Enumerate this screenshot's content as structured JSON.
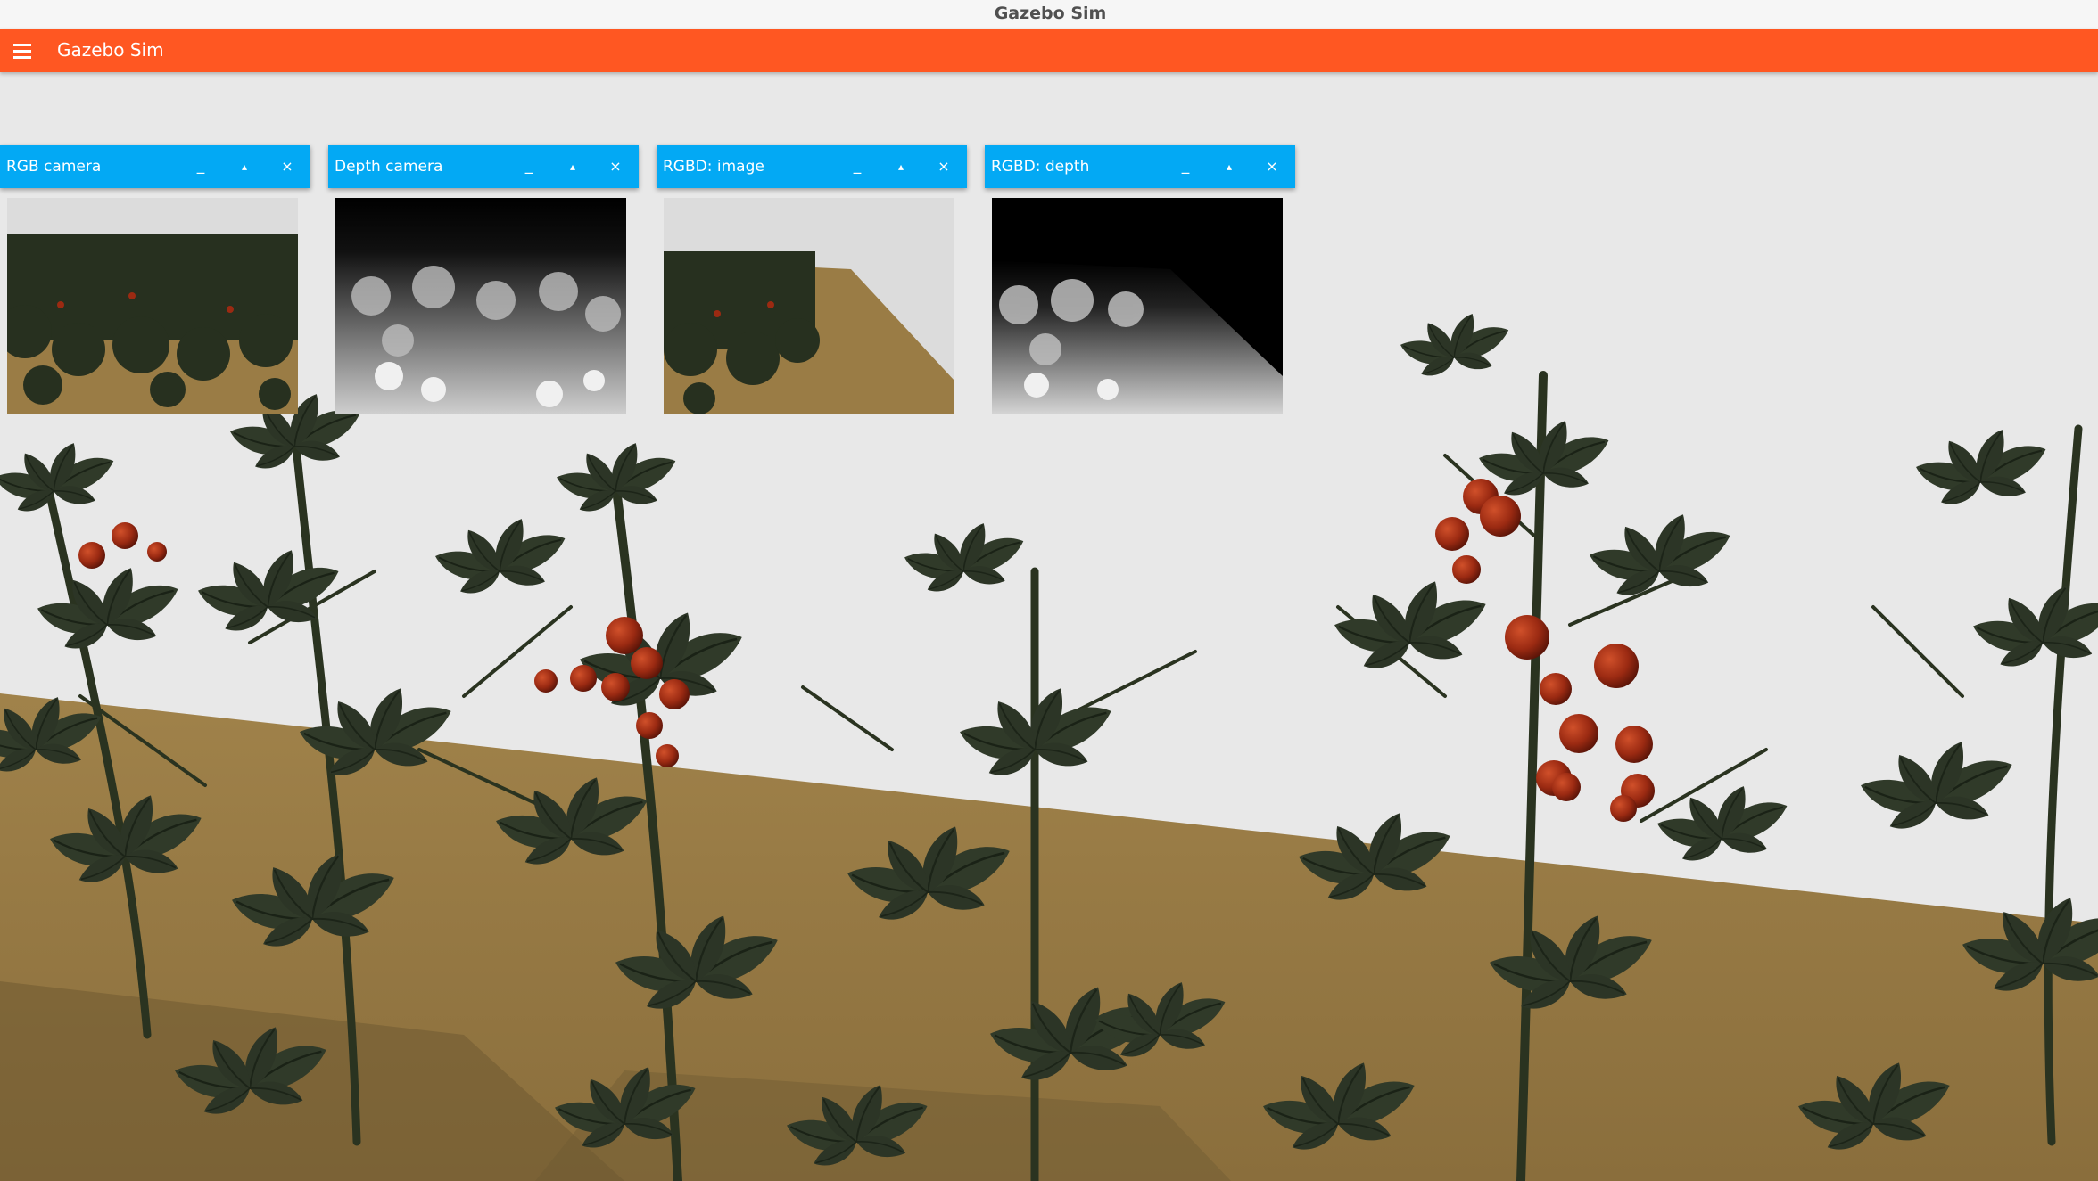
{
  "window": {
    "title": "Gazebo Sim"
  },
  "appbar": {
    "title": "Gazebo Sim",
    "menu_icon": "hamburger-menu-icon"
  },
  "panels": [
    {
      "title": "RGB camera",
      "minimize_label": "_",
      "float_label": "▴",
      "close_label": "×",
      "view": "rgb"
    },
    {
      "title": "Depth camera",
      "minimize_label": "_",
      "float_label": "▴",
      "close_label": "×",
      "view": "depth"
    },
    {
      "title": "RGBD: image",
      "minimize_label": "_",
      "float_label": "▴",
      "close_label": "×",
      "view": "rgbd-image"
    },
    {
      "title": "RGBD: depth",
      "minimize_label": "_",
      "float_label": "▴",
      "close_label": "×",
      "view": "rgbd-depth"
    }
  ],
  "colors": {
    "title_bar": "#f6f6f6",
    "app_bar": "#ff5722",
    "panel_header": "#03a9f4",
    "wall": "#e8e8e8",
    "ground": "#9a7c45",
    "foliage": "#2c3526",
    "tomato": "#9b2a12"
  }
}
